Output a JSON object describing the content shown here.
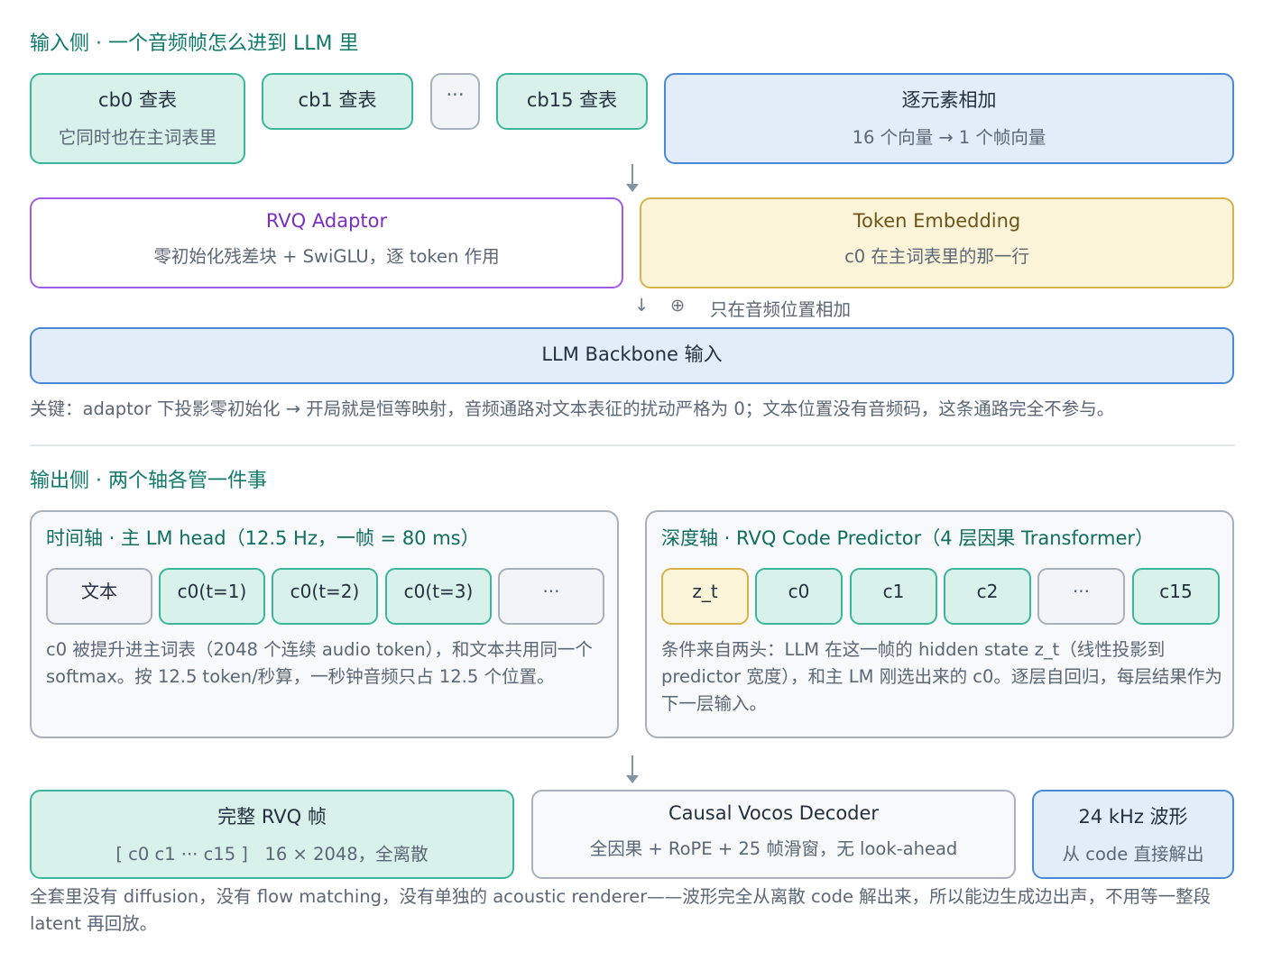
{
  "input_section": {
    "title": "输入侧 · 一个音频帧怎么进到 LLM 里",
    "cb0": {
      "title": "cb0 查表",
      "subtitle": "它同时也在主词表里"
    },
    "cb1": {
      "title": "cb1 查表"
    },
    "ellipsis": "···",
    "cb15": {
      "title": "cb15 查表"
    },
    "sum": {
      "title": "逐元素相加",
      "subtitle": "16 个向量 → 1 个帧向量"
    },
    "adaptor": {
      "title": "RVQ Adaptor",
      "subtitle": "零初始化残差块 + SwiGLU，逐 token 作用"
    },
    "token_embedding": {
      "title": "Token Embedding",
      "subtitle": "c0 在主词表里的那一行"
    },
    "merge_arrow": "↓",
    "merge_symbol": "⊕",
    "merge_label": "只在音频位置相加",
    "backbone": {
      "title": "LLM Backbone 输入"
    },
    "key_note": "关键：adaptor 下投影零初始化 → 开局就是恒等映射，音频通路对文本表征的扰动严格为 0；文本位置没有音频码，这条通路完全不参与。"
  },
  "output_section": {
    "title": "输出侧 · 两个轴各管一件事",
    "time_axis": {
      "title": "时间轴 · 主 LM head（12.5 Hz，一帧 = 80 ms）",
      "chips": [
        "文本",
        "c0(t=1)",
        "c0(t=2)",
        "c0(t=3)",
        "···"
      ],
      "description": "c0 被提升进主词表（2048 个连续 audio token），和文本共用同一个 softmax。按 12.5 token/秒算，一秒钟音频只占 12.5 个位置。"
    },
    "depth_axis": {
      "title": "深度轴 · RVQ Code Predictor（4 层因果 Transformer）",
      "chips": [
        "z_t",
        "c0",
        "c1",
        "c2",
        "···",
        "c15"
      ],
      "description": "条件来自两头：LLM 在这一帧的 hidden state z_t（线性投影到 predictor 宽度），和主 LM 刚选出来的 c0。逐层自回归，每层结果作为下一层输入。"
    },
    "full_frame": {
      "title": "完整 RVQ 帧",
      "subtitle": "[ c0 c1 ··· c15 ]   16 × 2048，全离散"
    },
    "decoder": {
      "title": "Causal Vocos Decoder",
      "subtitle": "全因果 + RoPE + 25 帧滑窗，无 look-ahead"
    },
    "waveform": {
      "title": "24 kHz 波形",
      "subtitle": "从 code 直接解出"
    },
    "bottom_note": "全套里没有 diffusion，没有 flow matching，没有单独的 acoustic renderer——波形完全从离散 code 解出来，所以能边生成边出声，不用等一整段 latent 再回放。"
  },
  "colors": {
    "teal": "#3cb69b",
    "blue": "#4a88d8",
    "purple": "#a15be6",
    "yellow": "#d9b14a",
    "gray": "#a8b0bd",
    "section_title": "#0f7a6c"
  }
}
